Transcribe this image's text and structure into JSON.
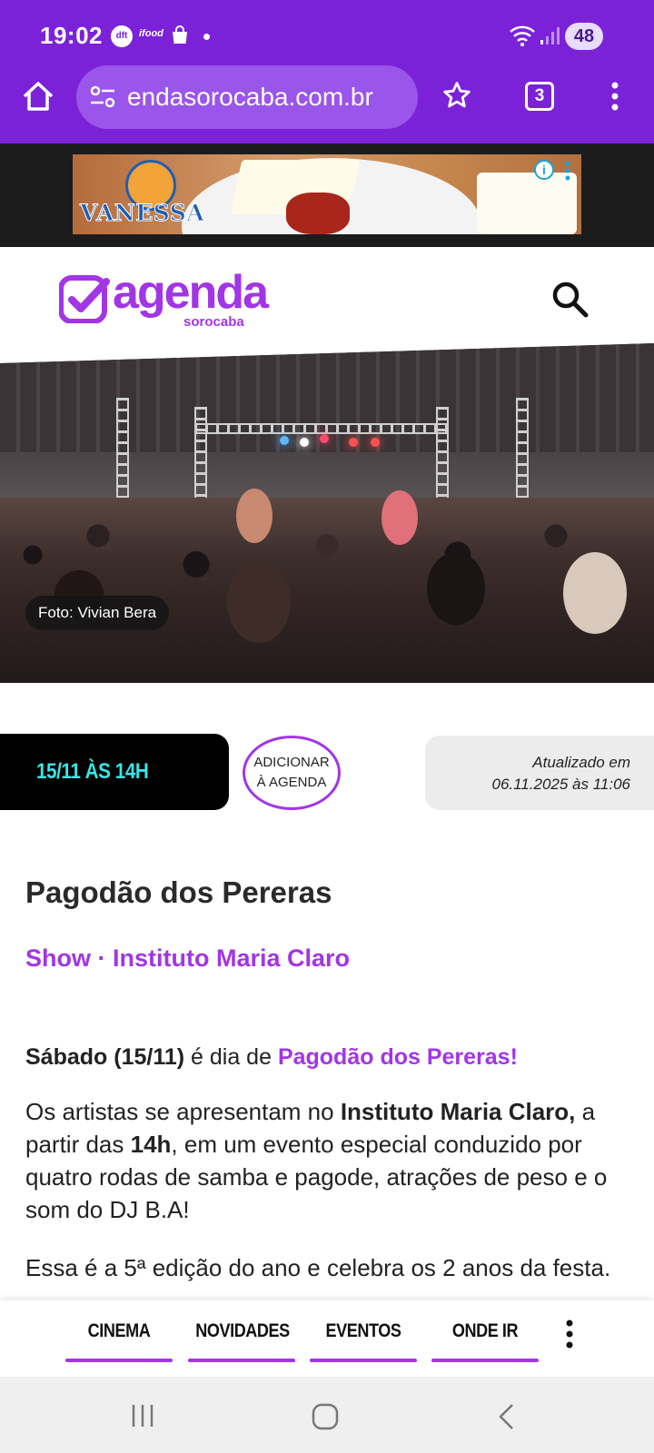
{
  "status_bar": {
    "time": "19:02",
    "notification_icons": [
      "dft",
      "ifood",
      "shopping-bag"
    ],
    "dft_label": "dft",
    "ifood_label": "ifood",
    "battery": "48"
  },
  "browser": {
    "url": "endasorocaba.com.br",
    "tab_count": "3"
  },
  "ad": {
    "brand": "VANESSA",
    "info_symbol": "i"
  },
  "site": {
    "logo_word": "agenda",
    "logo_sub": "sorocaba"
  },
  "hero": {
    "photo_credit": "Foto: Vivian Bera"
  },
  "event_meta": {
    "date": "15/11 ÀS 14H",
    "add_line1": "ADICIONAR",
    "add_line2": "À AGENDA",
    "updated_line1": "Atualizado em",
    "updated_line2": "06.11.2025 às 11:06"
  },
  "article": {
    "title": "Pagodão dos Pereras",
    "category": "Show · Instituto Maria Claro",
    "p1": {
      "a": "Sábado (15/11)",
      "b": " é dia de ",
      "c": "Pagodão dos Pereras!"
    },
    "p2": {
      "a": "Os artistas se apresentam no ",
      "b": "Instituto Maria Claro,",
      "c": " a partir das ",
      "d": "14h",
      "e": ", em um evento especial conduzido por quatro rodas de samba e pagode, atrações de peso e o som do DJ B.A!"
    },
    "p3": "Essa é a 5ª edição do ano e celebra os 2 anos da festa."
  },
  "bottom_nav": {
    "items": [
      {
        "label": "CINEMA"
      },
      {
        "label": "NOVIDADES"
      },
      {
        "label": "EVENTOS"
      },
      {
        "label": "ONDE IR"
      }
    ]
  },
  "colors": {
    "browser_purple": "#7b22d9",
    "brand_purple": "#a235e6",
    "date_cyan": "#39e5e8"
  }
}
